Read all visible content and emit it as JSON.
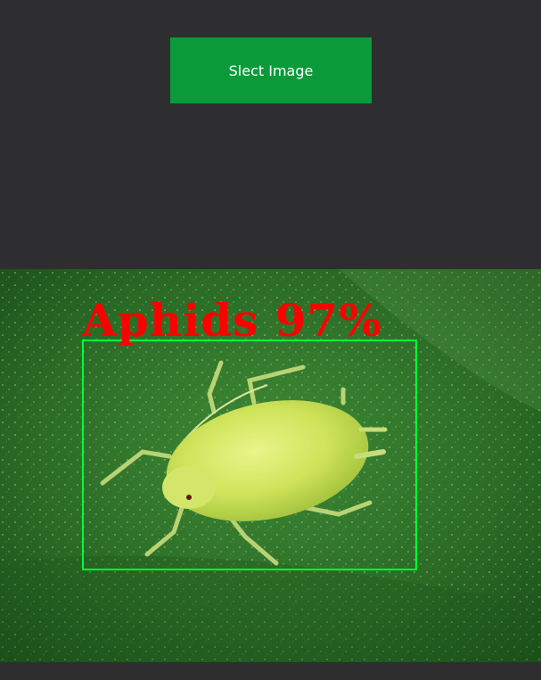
{
  "colors": {
    "background": "#2e2e30",
    "button": "#0b9a3a",
    "label": "#ff0000",
    "bbox": "#00ff33"
  },
  "toolbar": {
    "select_label": "Slect Image"
  },
  "detection": {
    "label": "Aphids 97%"
  }
}
